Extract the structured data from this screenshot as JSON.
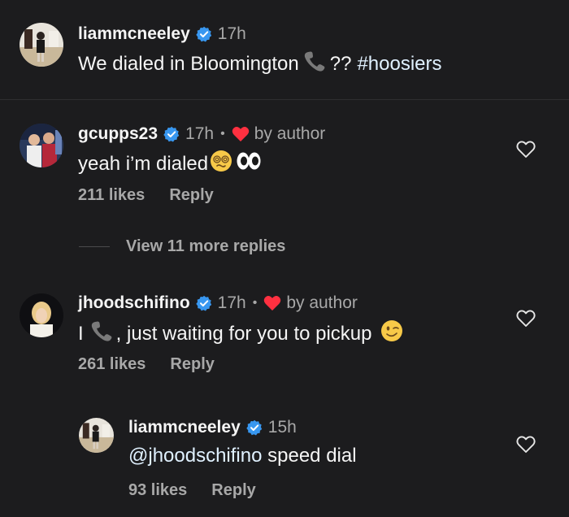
{
  "caption": {
    "username": "liammcneeley",
    "time": "17h",
    "text_before": "We dialed in Bloomington",
    "text_after": "??",
    "hashtag": "#hoosiers"
  },
  "comments": [
    {
      "username": "gcupps23",
      "time": "17h",
      "dot": "•",
      "liked_by": "by author",
      "text": "yeah i’m dialed",
      "likes": "211 likes",
      "reply": "Reply",
      "view_replies": "View 11 more replies"
    },
    {
      "username": "jhoodschifino",
      "time": "17h",
      "dot": "•",
      "liked_by": "by author",
      "text_before": "I",
      "text_after": ", just waiting for you to pickup",
      "likes": "261 likes",
      "reply": "Reply"
    }
  ],
  "reply": {
    "username": "liammcneeley",
    "time": "15h",
    "mention": "@jhoodschifino",
    "text": " speed dial",
    "likes": "93 likes",
    "reply": "Reply"
  },
  "icons": {
    "verified": "verified-badge-icon",
    "phone": "telephone-receiver-icon",
    "heart_red": "heart-filled-icon",
    "heart_outline": "heart-outline-icon",
    "dizzy_face": "face-with-spiral-eyes-icon",
    "eyes": "eyes-icon",
    "wink": "winking-face-icon"
  },
  "colors": {
    "background": "#1c1c1e",
    "verified": "#3897f0",
    "heart": "#ff3040",
    "secondary_text": "#a8a8a8"
  }
}
